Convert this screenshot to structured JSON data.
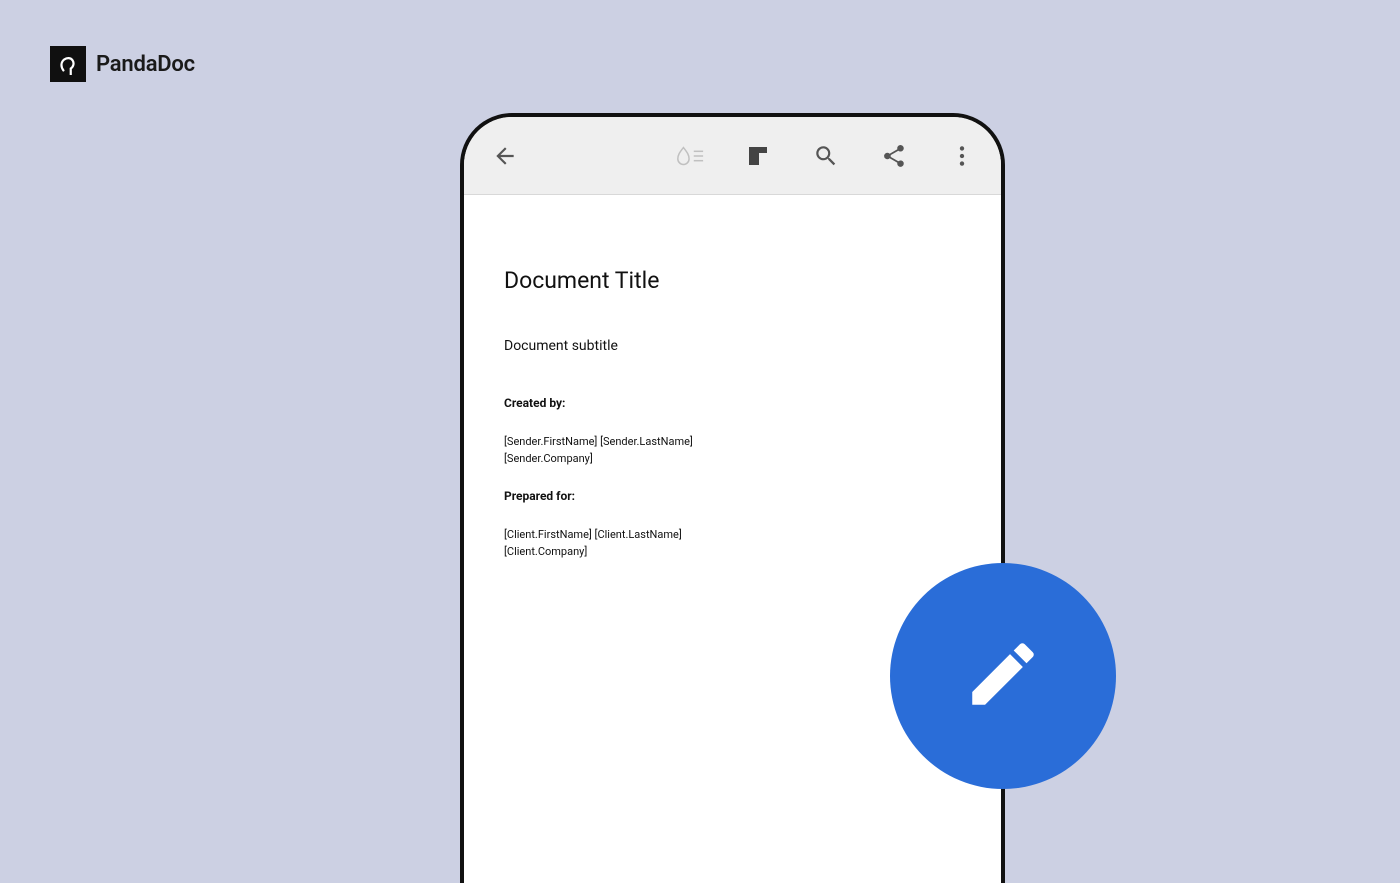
{
  "brand": {
    "name": "PandaDoc"
  },
  "toolbar": {
    "icons": {
      "back": "back-arrow-icon",
      "ink": "ink-drop-icon",
      "layout": "layout-icon",
      "search": "search-icon",
      "share": "share-icon",
      "more": "more-vertical-icon"
    }
  },
  "document": {
    "title": "Document Title",
    "subtitle": "Document subtitle",
    "created_by": {
      "label": "Created by:",
      "name": "[Sender.FirstName] [Sender.LastName]",
      "company": "[Sender.Company]"
    },
    "prepared_for": {
      "label": "Prepared for:",
      "name": "[Client.FirstName] [Client.LastName]",
      "company": "[Client.Company]"
    }
  },
  "fab": {
    "icon": "pencil-icon",
    "color": "#2a6dd8"
  }
}
